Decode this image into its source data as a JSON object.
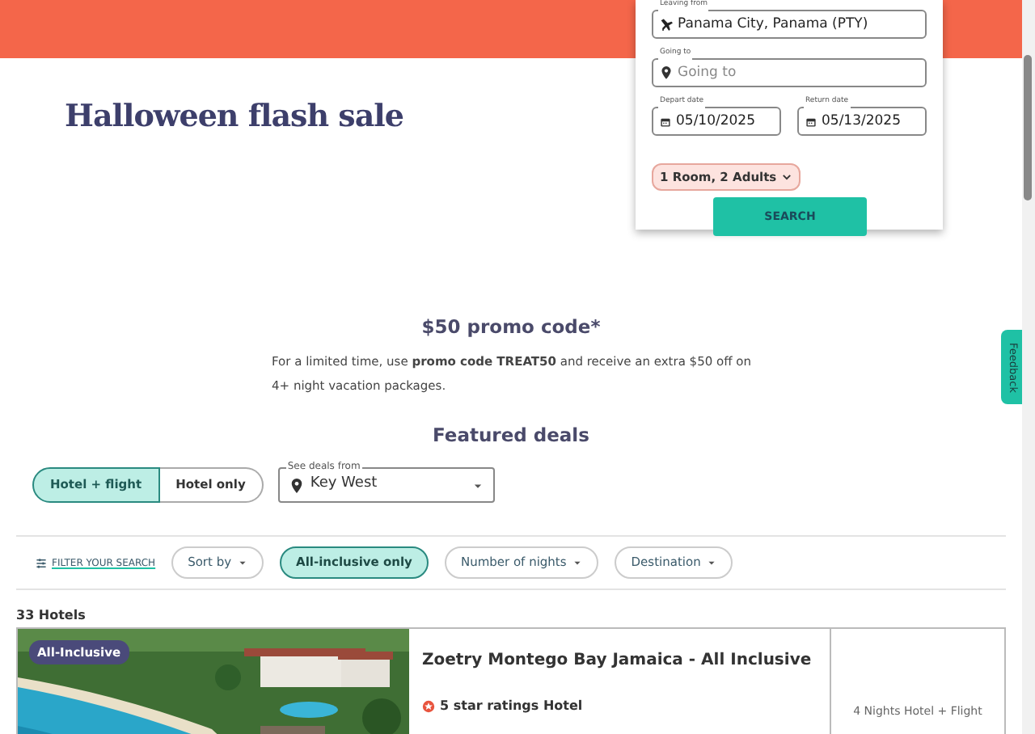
{
  "banner": {
    "title": "Halloween flash sale"
  },
  "search_form": {
    "fields": [
      {
        "label": "Leaving from",
        "value": "Panama City, Panama (PTY)",
        "kind": "plane"
      },
      {
        "label": "Going to",
        "placeholder": "Going to",
        "kind": "pin"
      }
    ],
    "dates": [
      {
        "label": "Depart date",
        "value": "05/10/2025"
      },
      {
        "label": "Return date",
        "value": "05/13/2025"
      }
    ],
    "guests": "1 Room, 2 Adults",
    "search_button": "SEARCH"
  },
  "promo": {
    "heading": "$50 promo code*",
    "text": "For a limited time, use **promo code TREAT50** and receive an extra $50 off on 4+ night vacation packages."
  },
  "featured": {
    "heading": "Featured deals",
    "modes": [
      {
        "label": "Hotel + flight",
        "selected": true
      },
      {
        "label": "Hotel only",
        "selected": false
      }
    ],
    "deals_from": {
      "label": "See deals from",
      "value": "Key West"
    }
  },
  "filters": {
    "link": "FILTER YOUR SEARCH",
    "chips": [
      {
        "label": "Sort by",
        "selected": false,
        "dropdown": true
      },
      {
        "label": "All-inclusive only",
        "selected": true,
        "dropdown": false
      },
      {
        "label": "Number of nights",
        "selected": false,
        "dropdown": true
      },
      {
        "label": "Destination",
        "selected": false,
        "dropdown": true
      }
    ]
  },
  "results": {
    "count": "33 Hotels",
    "hotels": [
      {
        "badge": "All-Inclusive",
        "name": "Zoetry Montego Bay Jamaica - All Inclusive",
        "rating": "5 star ratings Hotel",
        "package": "4 Nights Hotel + Flight"
      }
    ]
  },
  "feedback_tab": "Feedback"
}
